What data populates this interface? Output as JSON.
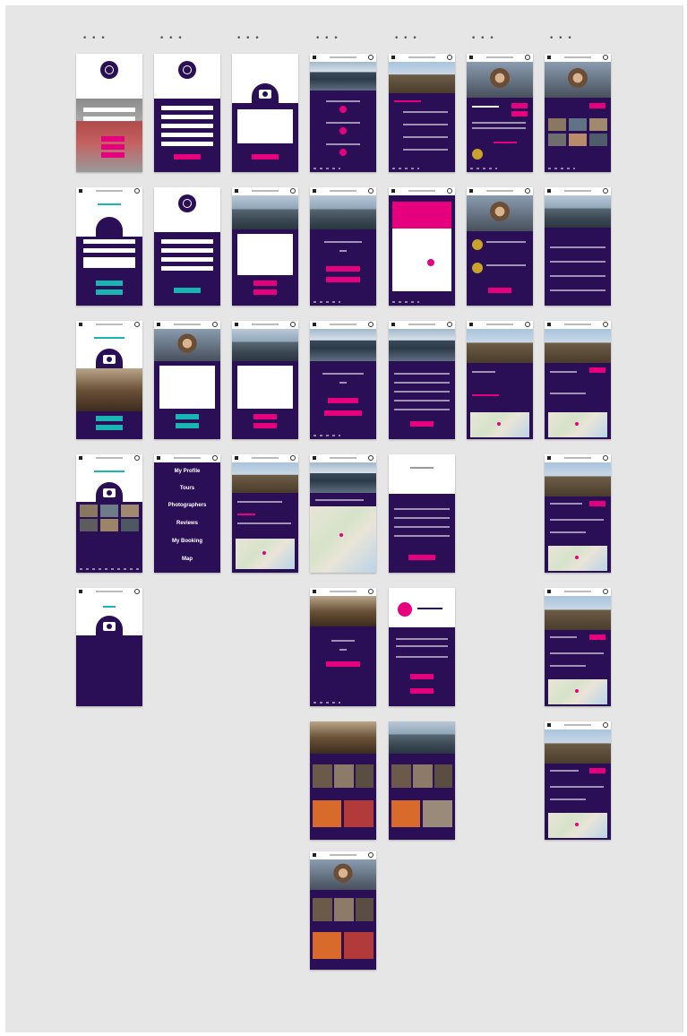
{
  "canvas": {
    "background": "#e6e6e6",
    "screen_purple": "#2a0f57",
    "accent_pink": "#e6007e",
    "accent_teal": "#19b5b3",
    "artboard_marker": "• • •"
  },
  "menu": {
    "items": [
      "My Profile",
      "Tours",
      "Photographers",
      "Reviews",
      "My Booking",
      "Map"
    ]
  },
  "icons": [
    "hamburger-icon",
    "logo-icon",
    "camera-icon",
    "map-pin-icon",
    "check-icon",
    "chevron-down-icon"
  ]
}
